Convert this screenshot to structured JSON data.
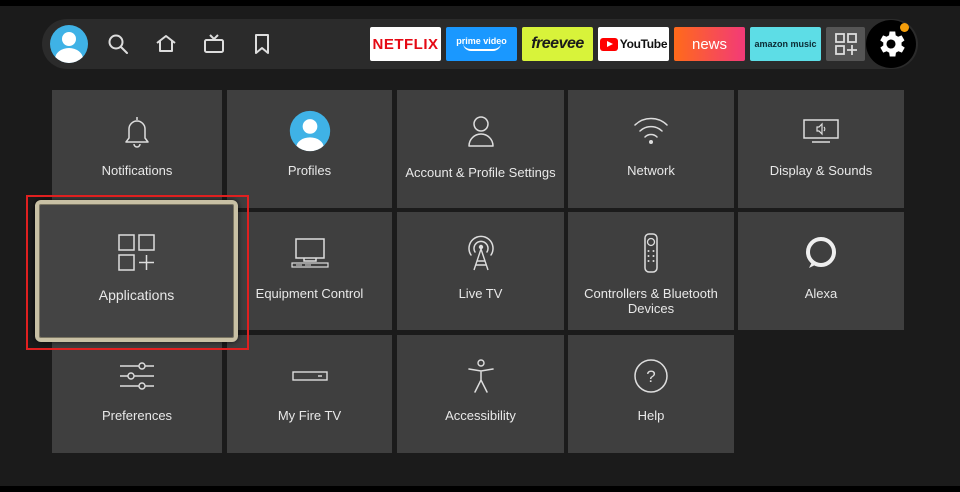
{
  "nav": {
    "icons": [
      "profile-avatar",
      "search-icon",
      "home-icon",
      "live-tv-icon",
      "bookmark-icon"
    ],
    "apps": [
      {
        "name": "netflix",
        "label": "NETFLIX"
      },
      {
        "name": "prime-video",
        "label": "prime video"
      },
      {
        "name": "freevee",
        "label": "freevee"
      },
      {
        "name": "youtube",
        "label": "YouTube"
      },
      {
        "name": "news",
        "label": "news"
      },
      {
        "name": "amazon-music",
        "label": "amazon music"
      },
      {
        "name": "all-apps",
        "label": ""
      }
    ],
    "settings_icon": "gear-icon",
    "notification_color": "#f59e0b"
  },
  "settings": {
    "tiles": [
      {
        "id": "notifications",
        "label": "Notifications",
        "icon": "bell-icon"
      },
      {
        "id": "profiles",
        "label": "Profiles",
        "icon": "profile-icon"
      },
      {
        "id": "account",
        "label": "Account & Profile Settings",
        "icon": "person-icon"
      },
      {
        "id": "network",
        "label": "Network",
        "icon": "wifi-icon"
      },
      {
        "id": "display",
        "label": "Display & Sounds",
        "icon": "display-sound-icon"
      },
      {
        "id": "applications",
        "label": "Applications",
        "icon": "apps-grid-icon",
        "selected": true
      },
      {
        "id": "equipment",
        "label": "Equipment Control",
        "icon": "tv-soundbar-icon"
      },
      {
        "id": "livetv",
        "label": "Live TV",
        "icon": "antenna-icon"
      },
      {
        "id": "controllers",
        "label": "Controllers & Bluetooth Devices",
        "icon": "remote-icon"
      },
      {
        "id": "alexa",
        "label": "Alexa",
        "icon": "alexa-icon"
      },
      {
        "id": "preferences",
        "label": "Preferences",
        "icon": "sliders-icon"
      },
      {
        "id": "myfiretv",
        "label": "My Fire TV",
        "icon": "fire-tv-stick-icon"
      },
      {
        "id": "accessibility",
        "label": "Accessibility",
        "icon": "accessibility-icon"
      },
      {
        "id": "help",
        "label": "Help",
        "icon": "help-icon"
      }
    ]
  },
  "colors": {
    "background": "#1b1b1b",
    "tile": "#3f3f3f",
    "selected_border": "#c8c0a4",
    "highlight_box": "#e02020",
    "accent_blue": "#3fb2e6"
  }
}
